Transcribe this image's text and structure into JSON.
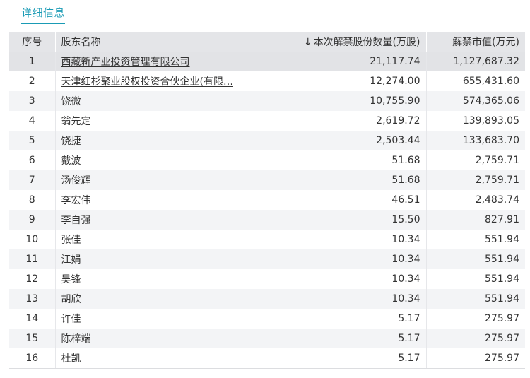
{
  "tab": {
    "label": "详细信息"
  },
  "table": {
    "headers": {
      "idx": "序号",
      "name": "股东名称",
      "qty_icon": "arrow-down-icon",
      "qty": "本次解禁股份数量(万股)",
      "value": "解禁市值(万元)"
    },
    "rows": [
      {
        "idx": "1",
        "name": "西藏新产业投资管理有限公司",
        "qty": "21,117.74",
        "value": "1,127,687.32"
      },
      {
        "idx": "2",
        "name": "天津红杉聚业股权投资合伙企业(有限…",
        "qty": "12,274.00",
        "value": "655,431.60"
      },
      {
        "idx": "3",
        "name": "饶微",
        "qty": "10,755.90",
        "value": "574,365.06"
      },
      {
        "idx": "4",
        "name": "翁先定",
        "qty": "2,619.72",
        "value": "139,893.05"
      },
      {
        "idx": "5",
        "name": "饶捷",
        "qty": "2,503.44",
        "value": "133,683.70"
      },
      {
        "idx": "6",
        "name": "戴波",
        "qty": "51.68",
        "value": "2,759.71"
      },
      {
        "idx": "7",
        "name": "汤俊辉",
        "qty": "51.68",
        "value": "2,759.71"
      },
      {
        "idx": "8",
        "name": "李宏伟",
        "qty": "46.51",
        "value": "2,483.74"
      },
      {
        "idx": "9",
        "name": "李自强",
        "qty": "15.50",
        "value": "827.91"
      },
      {
        "idx": "10",
        "name": "张佳",
        "qty": "10.34",
        "value": "551.94"
      },
      {
        "idx": "11",
        "name": "江娟",
        "qty": "10.34",
        "value": "551.94"
      },
      {
        "idx": "12",
        "name": "吴锋",
        "qty": "10.34",
        "value": "551.94"
      },
      {
        "idx": "13",
        "name": "胡欣",
        "qty": "10.34",
        "value": "551.94"
      },
      {
        "idx": "14",
        "name": "许佳",
        "qty": "5.17",
        "value": "275.97"
      },
      {
        "idx": "15",
        "name": "陈梓端",
        "qty": "5.17",
        "value": "275.97"
      },
      {
        "idx": "16",
        "name": "杜凯",
        "qty": "5.17",
        "value": "275.97"
      }
    ]
  }
}
